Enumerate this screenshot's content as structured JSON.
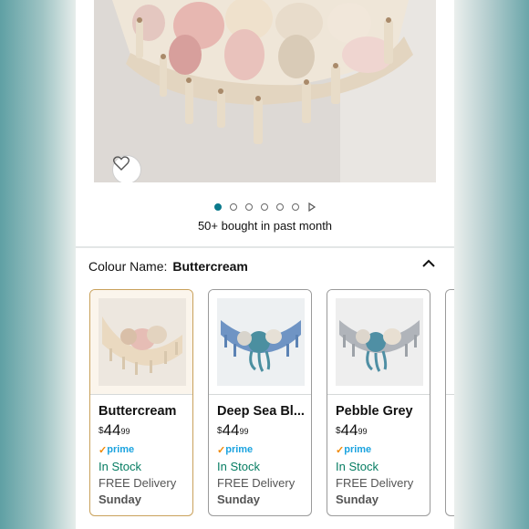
{
  "product": {
    "bought_text": "50+ bought in past month",
    "image_count": 6,
    "active_image_index": 0
  },
  "colour": {
    "label": "Colour Name:",
    "selected": "Buttercream"
  },
  "variants": [
    {
      "name": "Buttercream",
      "currency": "$",
      "price_whole": "44",
      "price_fraction": "99",
      "prime": "prime",
      "stock": "In Stock",
      "delivery": "FREE Delivery",
      "day": "Sunday",
      "selected": true,
      "accent": "#e8d3b8"
    },
    {
      "name": "Deep Sea Bl...",
      "currency": "$",
      "price_whole": "44",
      "price_fraction": "99",
      "prime": "prime",
      "stock": "In Stock",
      "delivery": "FREE Delivery",
      "day": "Sunday",
      "selected": false,
      "accent": "#5d86b8"
    },
    {
      "name": "Pebble Grey",
      "currency": "$",
      "price_whole": "44",
      "price_fraction": "99",
      "prime": "prime",
      "stock": "In Stock",
      "delivery": "FREE Delivery",
      "day": "Sunday",
      "selected": false,
      "accent": "#a9adb3"
    }
  ],
  "colors": {
    "dot_active": "#0b7a8c",
    "in_stock": "#067d62",
    "prime_blue": "#1ba3df",
    "selected_border": "#c9a15b"
  },
  "icons": [
    "heart-icon",
    "play-icon",
    "chevron-up-icon",
    "prime-check-icon"
  ]
}
